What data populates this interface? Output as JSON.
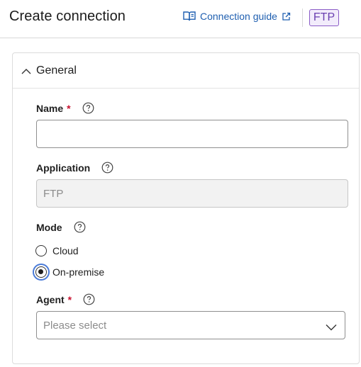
{
  "header": {
    "title": "Create connection",
    "guide_label": "Connection guide",
    "app_badge": "FTP"
  },
  "panel": {
    "title": "General"
  },
  "fields": {
    "name": {
      "label": "Name",
      "required_mark": "*",
      "value": ""
    },
    "application": {
      "label": "Application",
      "value": "FTP"
    },
    "mode": {
      "label": "Mode",
      "options": [
        "Cloud",
        "On-premise"
      ],
      "selected": "On-premise"
    },
    "agent": {
      "label": "Agent",
      "required_mark": "*",
      "placeholder": "Please select"
    }
  },
  "colors": {
    "link": "#1f5fb0",
    "badge_border": "#8a5cc7",
    "required": "#c8102e",
    "focus_ring": "#4a7bd8"
  },
  "icons": [
    "book-open-icon",
    "external-link-icon",
    "chevron-up-icon",
    "help-circle-icon",
    "chevron-down-icon"
  ]
}
